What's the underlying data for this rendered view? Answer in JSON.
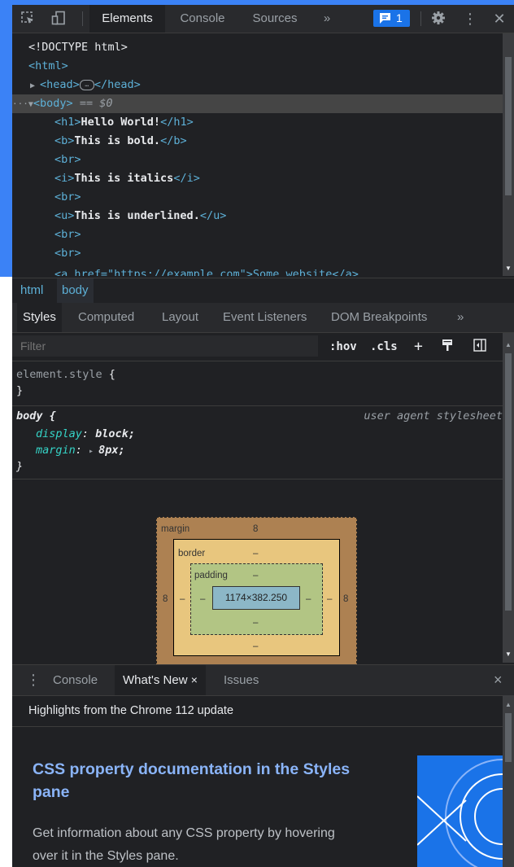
{
  "toolbar": {
    "tabs": [
      {
        "label": "Elements",
        "active": true
      },
      {
        "label": "Console",
        "active": false
      },
      {
        "label": "Sources",
        "active": false
      }
    ],
    "more_label": "»",
    "issues_count": "1",
    "icons": [
      "inspect-icon",
      "device-toggle-icon",
      "issues-icon",
      "gear-icon",
      "kebab-menu-icon",
      "close-icon"
    ]
  },
  "elements": {
    "lines": {
      "doctype": "<!DOCTYPE html>",
      "html_open": "<html>",
      "head_open": "<head>",
      "head_ellipsis": "…",
      "head_close": "</head>",
      "body_open": "<body>",
      "body_eq": " == $0",
      "h1_open": "<h1>",
      "h1_text": "Hello World!",
      "h1_close": "</h1>",
      "b_open": "<b>",
      "b_text": "This is bold.",
      "b_close": "</b>",
      "br": "<br>",
      "i_open": "<i>",
      "i_text": "This is italics",
      "i_close": "</i>",
      "u_open": "<u>",
      "u_text": "This is underlined.",
      "u_close": "</u>",
      "partial": "<a href=\"https://example.com\">Some website</a>"
    },
    "dots": "···"
  },
  "breadcrumb": {
    "items": [
      "html",
      "body"
    ]
  },
  "styles_tabs": {
    "tabs": [
      "Styles",
      "Computed",
      "Layout",
      "Event Listeners",
      "DOM Breakpoints"
    ],
    "more_label": "»"
  },
  "filter": {
    "placeholder": "Filter",
    "hov": ":hov",
    "cls": ".cls",
    "plus": "+"
  },
  "rules": {
    "element_style": {
      "selector": "element.style",
      "open": " {",
      "close": "}"
    },
    "body": {
      "selector": "body",
      "open": " {",
      "source": "user agent stylesheet",
      "declarations": [
        {
          "prop": "display",
          "colon": ": ",
          "value": "block",
          "semi": ";"
        },
        {
          "prop": "margin",
          "colon": ": ",
          "arrow": "▸ ",
          "value": "8px",
          "semi": ";"
        }
      ],
      "close": "}"
    }
  },
  "box_model": {
    "margin_label": "margin",
    "margin_top": "8",
    "margin_left": "8",
    "margin_right": "8",
    "margin_bottom": "-",
    "border_label": "border",
    "border_top": "–",
    "border_left": "–",
    "border_right": "–",
    "border_bottom": "–",
    "padding_label": "padding",
    "padding_top": "–",
    "padding_left": "–",
    "padding_right": "–",
    "padding_bottom": "–",
    "content": "1174×382.250"
  },
  "drawer": {
    "tabs": [
      {
        "label": "Console",
        "active": false
      },
      {
        "label": "What's New",
        "active": true
      },
      {
        "label": "Issues",
        "active": false
      }
    ],
    "close_tab": "×",
    "close": "×",
    "menu": "⋮"
  },
  "whats_new": {
    "header": "Highlights from the Chrome 112 update",
    "title": "CSS property documentation in the Styles pane",
    "description": "Get information about any CSS property by hovering over it in the Styles pane."
  },
  "colors": {
    "panel_bg": "#202124",
    "toolbar_bg": "#292a2d",
    "tag": "#5db0d7",
    "prop": "#35d4c7",
    "link": "#8ab4f8",
    "accent": "#1a73e8"
  }
}
